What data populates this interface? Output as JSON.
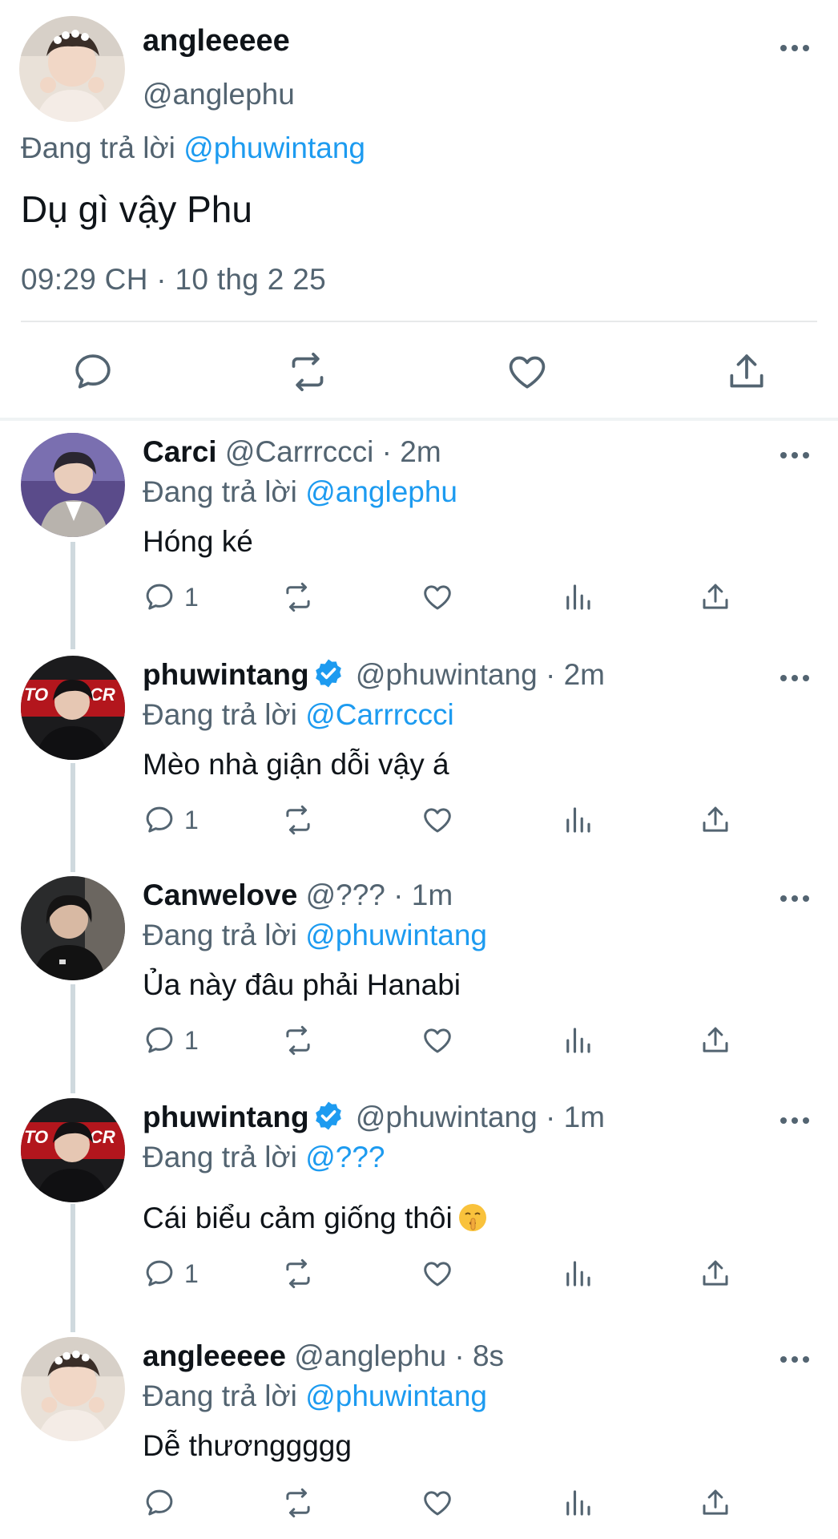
{
  "main_tweet": {
    "display_name": "angleeeee",
    "handle": "@anglephu",
    "replying_prefix": "Đang trả lời",
    "replying_to": "@phuwintang",
    "text": "Dụ gì vậy Phu",
    "timestamp": "09:29 CH · 10 thg 2 25",
    "actions": [
      "reply-icon",
      "retweet-icon",
      "like-icon",
      "share-icon"
    ]
  },
  "replies": [
    {
      "display_name": "Carci",
      "handle": "@Carrrccci",
      "time": "· 2m",
      "verified": false,
      "replying_prefix": "Đang trả lời",
      "replying_to": "@anglephu",
      "text": "Hóng ké",
      "reply_count": "1"
    },
    {
      "display_name": "phuwintang",
      "handle": "@phuwintang",
      "time": "· 2m",
      "verified": true,
      "replying_prefix": "Đang trả lời",
      "replying_to": "@Carrrccci",
      "text": "Mèo nhà giận dỗi vậy á",
      "reply_count": "1"
    },
    {
      "display_name": "Canwelove",
      "handle": "@???",
      "time": "· 1m",
      "verified": false,
      "replying_prefix": "Đang trả lời",
      "replying_to": "@phuwintang",
      "text": "Ủa này đâu phải Hanabi",
      "reply_count": "1"
    },
    {
      "display_name": "phuwintang",
      "handle": "@phuwintang",
      "time": "· 1m",
      "verified": true,
      "replying_prefix": "Đang trả lời",
      "replying_to": "@???",
      "text": "Cái biểu cảm giống thôi",
      "reply_count": "1"
    },
    {
      "display_name": "angleeeee",
      "handle": "@anglephu",
      "time": "· 8s",
      "verified": false,
      "replying_prefix": "Đang trả lời",
      "replying_to": "@phuwintang",
      "text": "Dễ thươnggggg",
      "reply_count": ""
    }
  ],
  "colors": {
    "link": "#1d9bf0",
    "secondary_text": "#536471",
    "verified_badge": "#1d9bf0",
    "thread_line": "#cfd9de"
  }
}
